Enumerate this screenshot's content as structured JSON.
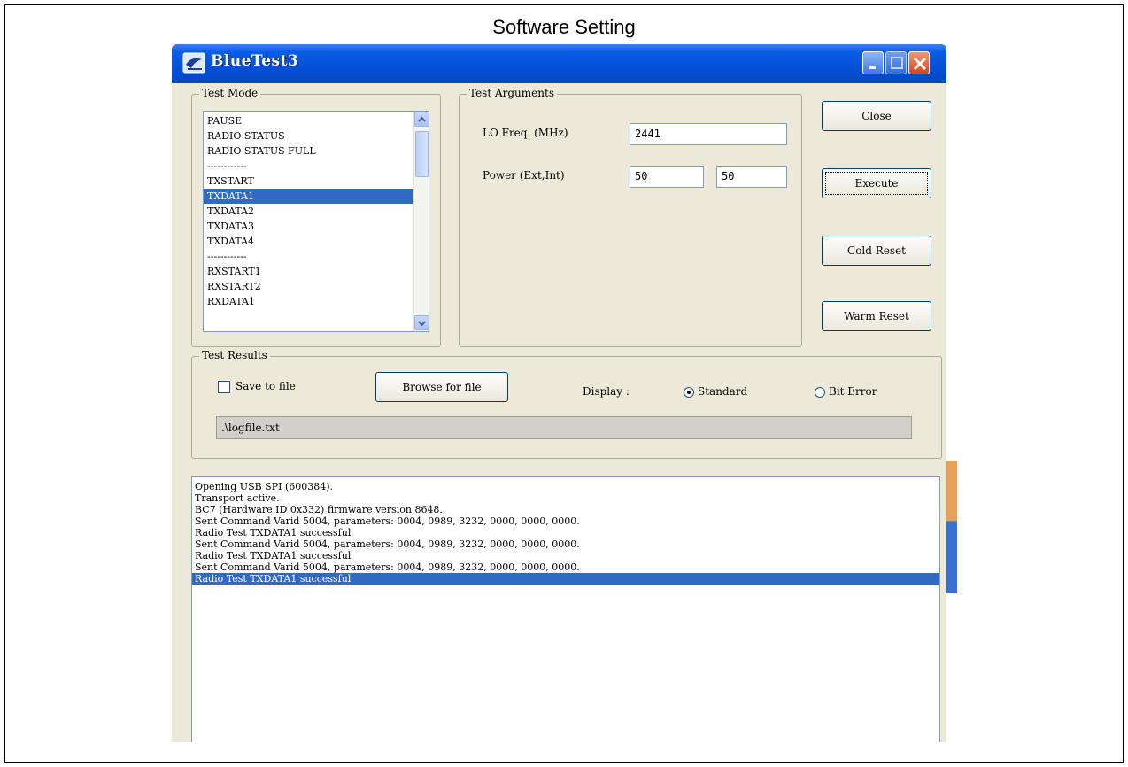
{
  "caption": "Software Setting",
  "window": {
    "title": "BlueTest3",
    "controls": {
      "minimize": "minimize",
      "maximize": "maximize",
      "close": "close"
    }
  },
  "test_mode": {
    "label": "Test Mode",
    "items": [
      "PAUSE",
      "RADIO STATUS",
      "RADIO STATUS FULL",
      "------------",
      "TXSTART",
      "TXDATA1",
      "TXDATA2",
      "TXDATA3",
      "TXDATA4",
      "------------",
      "RXSTART1",
      "RXSTART2",
      "RXDATA1"
    ],
    "selected": "TXDATA1"
  },
  "test_arguments": {
    "label": "Test Arguments",
    "lo_freq_label": "LO Freq. (MHz)",
    "lo_freq_value": "2441",
    "power_label": "Power (Ext,Int)",
    "power_ext_value": "50",
    "power_int_value": "50"
  },
  "buttons": {
    "close": "Close",
    "execute": "Execute",
    "cold_reset": "Cold Reset",
    "warm_reset": "Warm Reset"
  },
  "test_results": {
    "label": "Test Results",
    "save_to_file_label": "Save to file",
    "save_to_file_checked": false,
    "browse_label": "Browse for file",
    "display_label": "Display :",
    "radio_standard": "Standard",
    "radio_bit_error": "Bit Error",
    "display_selected": "Standard",
    "logfile_path": ".\\logfile.txt"
  },
  "log": {
    "lines": [
      "Opening USB SPI (600384).",
      "Transport active.",
      "BC7 (Hardware ID 0x332) firmware version 8648.",
      "Sent Command Varid 5004, parameters: 0004, 0989, 3232, 0000, 0000, 0000.",
      "Radio Test TXDATA1 successful",
      "Sent Command Varid 5004, parameters: 0004, 0989, 3232, 0000, 0000, 0000.",
      "Radio Test TXDATA1 successful",
      "Sent Command Varid 5004, parameters: 0004, 0989, 3232, 0000, 0000, 0000.",
      "Radio Test TXDATA1 successful"
    ],
    "selected_index": 8
  },
  "colors": {
    "titlebar": "#0550d6",
    "selection": "#316ac5",
    "window_bg": "#ece9d8",
    "close_button": "#d9431f"
  }
}
